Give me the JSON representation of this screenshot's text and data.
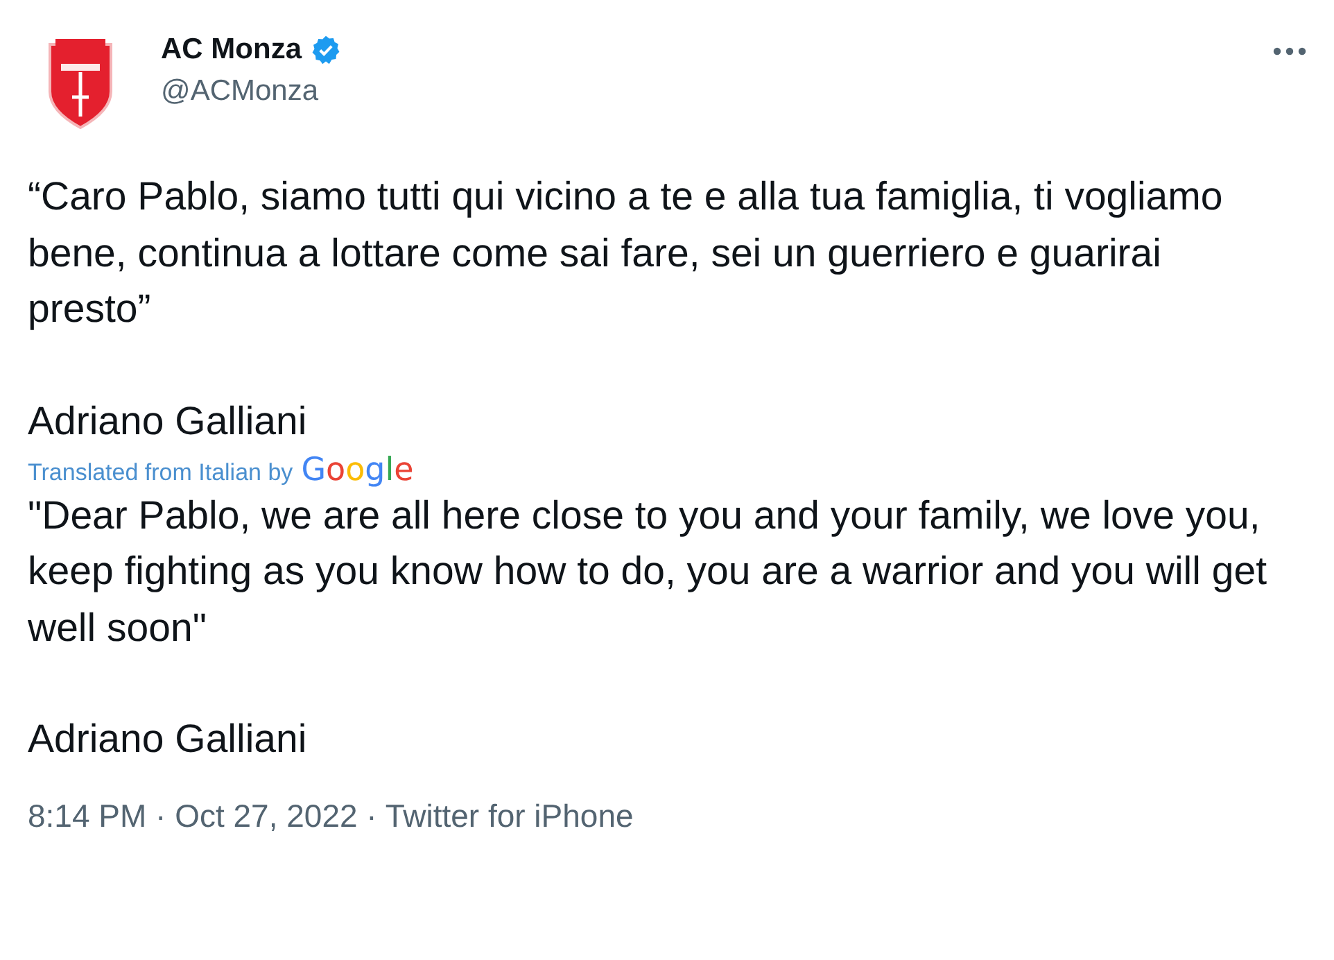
{
  "author": {
    "name": "AC Monza",
    "verified": true,
    "handle": "@ACMonza"
  },
  "tweet": {
    "text": "“Caro Pablo, siamo tutti qui vicino a te e alla tua famiglia, ti vogliamo bene, continua a lottare come sai fare, sei un guerriero e guarirai presto”",
    "signature": "Adriano Galliani"
  },
  "translation": {
    "label": "Translated from Italian by",
    "provider": "Google",
    "text": "\"Dear Pablo, we are all here close to you and your family, we love you, keep fighting as you know how to do, you are a warrior and you will get well soon\"",
    "signature": "Adriano Galliani"
  },
  "timestamp": "8:14 PM · Oct 27, 2022 · Twitter for iPhone"
}
